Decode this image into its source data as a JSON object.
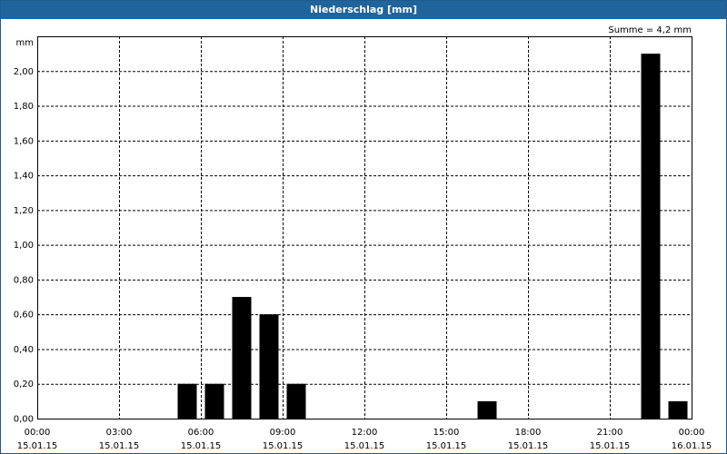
{
  "window": {
    "title": "Niederschlag [mm]"
  },
  "chart_data": {
    "type": "bar",
    "title": "Niederschlag [mm]",
    "ylabel": "mm",
    "annotation": "Summe = 4,2 mm",
    "ylim": [
      0,
      2.2
    ],
    "xlim_hours": [
      0,
      24
    ],
    "grid": true,
    "y_ticks": [
      {
        "value": 0,
        "label": "0,00"
      },
      {
        "value": 0.2,
        "label": "0,20"
      },
      {
        "value": 0.4,
        "label": "0,40"
      },
      {
        "value": 0.6,
        "label": "0,60"
      },
      {
        "value": 0.8,
        "label": "0,80"
      },
      {
        "value": 1.0,
        "label": "1,00"
      },
      {
        "value": 1.2,
        "label": "1,20"
      },
      {
        "value": 1.4,
        "label": "1,40"
      },
      {
        "value": 1.6,
        "label": "1,60"
      },
      {
        "value": 1.8,
        "label": "1,80"
      },
      {
        "value": 2.0,
        "label": "2,00"
      }
    ],
    "x_ticks": [
      {
        "hour": 0,
        "time": "00:00",
        "date": "15.01.15"
      },
      {
        "hour": 3,
        "time": "03:00",
        "date": "15.01.15"
      },
      {
        "hour": 6,
        "time": "06:00",
        "date": "15.01.15"
      },
      {
        "hour": 9,
        "time": "09:00",
        "date": "15.01.15"
      },
      {
        "hour": 12,
        "time": "12:00",
        "date": "15.01.15"
      },
      {
        "hour": 15,
        "time": "15:00",
        "date": "15.01.15"
      },
      {
        "hour": 18,
        "time": "18:00",
        "date": "15.01.15"
      },
      {
        "hour": 21,
        "time": "21:00",
        "date": "15.01.15"
      },
      {
        "hour": 24,
        "time": "00:00",
        "date": "16.01.15"
      }
    ],
    "bars": [
      {
        "hour": 5.5,
        "value": 0.2
      },
      {
        "hour": 6.5,
        "value": 0.2
      },
      {
        "hour": 7.5,
        "value": 0.7
      },
      {
        "hour": 8.5,
        "value": 0.6
      },
      {
        "hour": 9.5,
        "value": 0.2
      },
      {
        "hour": 16.5,
        "value": 0.1
      },
      {
        "hour": 22.5,
        "value": 2.1
      },
      {
        "hour": 23.5,
        "value": 0.1
      }
    ],
    "colors": {
      "bar": "#000000",
      "titlebar": "#20649c",
      "grid": "#000000"
    }
  }
}
